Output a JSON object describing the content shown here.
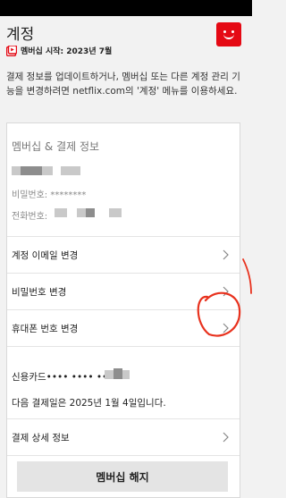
{
  "header": {
    "title": "계정",
    "member_since": "멤버십 시작: 2023년 7월"
  },
  "description": "결제 정보를 업데이트하거나, 멤버십 또는 다른 계정 관리 기능을 변경하려면 netflix.com의 '계정' 메뉴를 이용하세요.",
  "membership": {
    "section_title": "멤버십 & 결제 정보",
    "password_label": "비밀번호: ********",
    "phone_label": "전화번호:",
    "rows": [
      {
        "label": "계정 이메일 변경"
      },
      {
        "label": "비밀번호 변경"
      },
      {
        "label": "휴대폰 번호 변경"
      }
    ],
    "card_label": "신용카드•••• •••• ••••",
    "next_payment": "다음 결제일은 2025년 1월 4일입니다.",
    "billing_details": "결제 상세 정보",
    "cancel_button": "멤버십 해지"
  },
  "colors": {
    "brand_red": "#e50914",
    "annotation_red": "#e8321e"
  }
}
